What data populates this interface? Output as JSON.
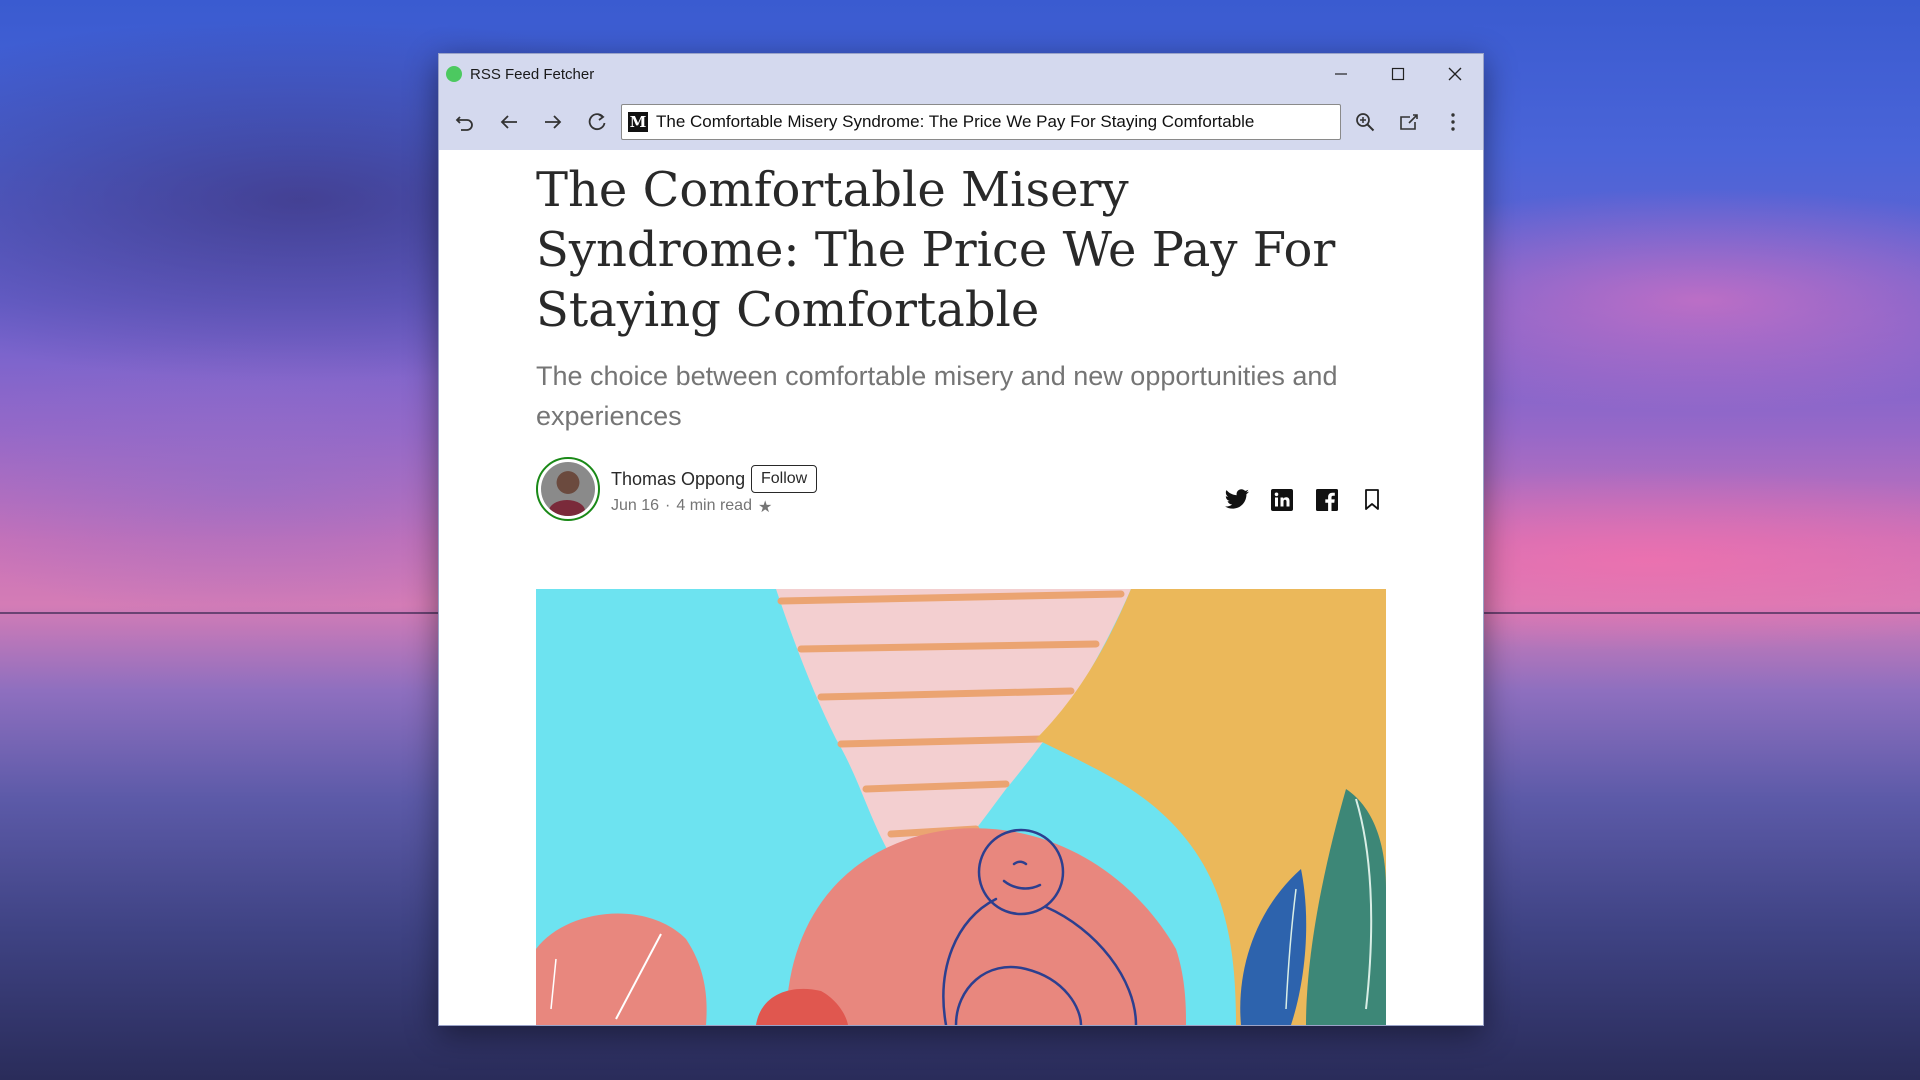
{
  "window": {
    "app_title": "RSS Feed Fetcher",
    "url_bar_text": "The Comfortable Misery Syndrome: The Price We Pay For Staying Comfortable",
    "site_icon_letter": "M",
    "controls": {
      "minimize": "minimize-icon",
      "maximize": "maximize-icon",
      "close": "close-icon"
    },
    "toolbar_icons": [
      "undo-icon",
      "back-icon",
      "forward-icon",
      "reload-icon",
      "zoom-icon",
      "share-out-icon",
      "more-icon"
    ],
    "app_dot_color": "#4cc960"
  },
  "article": {
    "headline": "The Comfortable Misery Syndrome: The Price We Pay For Staying Comfortable",
    "subtitle": "The choice between comfortable misery and new opportunities and experiences",
    "author": "Thomas Oppong",
    "follow_label": "Follow",
    "date": "Jun 16",
    "separator": "·",
    "read_time": "4 min read",
    "star": "★",
    "share_icons": [
      "twitter-icon",
      "linkedin-icon",
      "facebook-icon",
      "bookmark-icon"
    ]
  },
  "colors": {
    "titlebar": "#d4d9ee",
    "headline": "#292929",
    "subtitle": "#757575",
    "author_ring": "#1a8917"
  }
}
